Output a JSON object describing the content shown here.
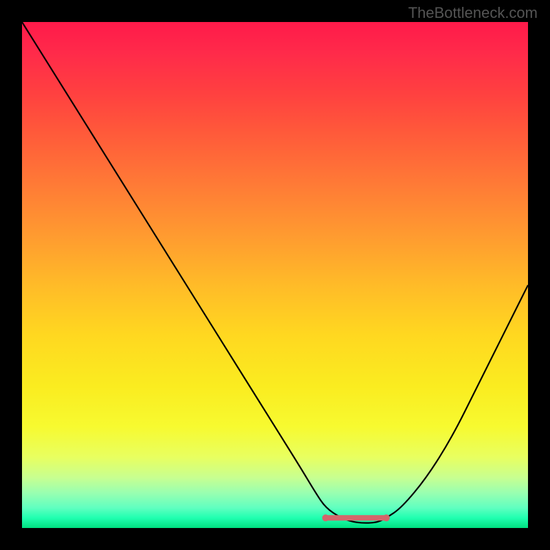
{
  "watermark": "TheBottleneck.com",
  "chart_data": {
    "type": "line",
    "title": "",
    "xlabel": "",
    "ylabel": "",
    "xlim": [
      0,
      100
    ],
    "ylim": [
      0,
      100
    ],
    "series": [
      {
        "name": "bottleneck-curve",
        "x": [
          0,
          5,
          10,
          15,
          20,
          25,
          30,
          35,
          40,
          45,
          50,
          55,
          58,
          60,
          63,
          66,
          70,
          72,
          75,
          80,
          85,
          90,
          95,
          100
        ],
        "values": [
          100,
          92,
          84,
          76,
          68,
          60,
          52,
          44,
          36,
          28,
          20,
          12,
          7,
          4,
          2,
          1,
          1,
          2,
          4,
          10,
          18,
          28,
          38,
          48
        ]
      }
    ],
    "optimal_zone": {
      "marker_name": "optimal-range-marker",
      "x_start": 60,
      "x_end": 72,
      "y": 2
    },
    "gradient_stops": [
      {
        "pos": 0,
        "color": "#ff1a4a"
      },
      {
        "pos": 50,
        "color": "#ffd820"
      },
      {
        "pos": 100,
        "color": "#00e080"
      }
    ]
  }
}
